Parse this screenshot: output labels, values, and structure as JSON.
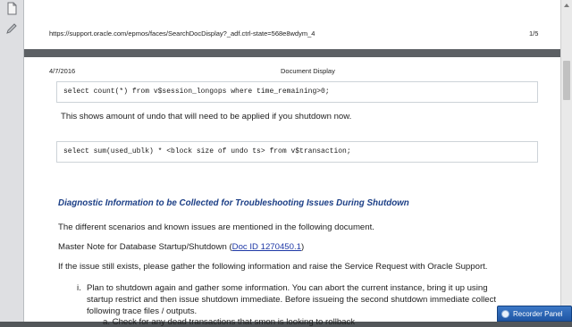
{
  "previous_page": {
    "url": "https://support.oracle.com/epmos/faces/SearchDocDisplay?_adf.ctrl-state=568e8wdym_4",
    "page_number": "1/5"
  },
  "current_page": {
    "date": "4/7/2016",
    "doc_title": "Document Display",
    "code1": "select count(*) from v$session_longops where time_remaining>0;",
    "text1": "This shows amount of undo that will need to be applied if you shutdown now.",
    "code2": "select sum(used_ublk) * <block size of undo ts> from v$transaction;",
    "heading": "Diagnostic Information to be Collected for Troubleshooting Issues During Shutdown",
    "p1": "The different scenarios and known issues are mentioned in the following document.",
    "p2_prefix": "Master Note for Database Startup/Shutdown (",
    "p2_link": "Doc ID 1270450.1",
    "p2_suffix": ")",
    "p3": "If the issue still exists, please gather the following information and raise the Service Request with Oracle Support.",
    "list_item_i_marker": "i.",
    "list_item_i_line1": "Plan to shutdown again and gather some information. You can abort the current instance, bring it up using",
    "list_item_i_line2": "startup restrict and then issue shutdown immediate. Before issueing the second shutdown immediate collect",
    "list_item_i_line3": "following trace files / outputs.",
    "sub_item_a": "a.  Check for any dead transactions that smon is looking to rollback"
  },
  "taskbar": {
    "recorder_label": "Recorder Panel"
  },
  "icons": {
    "sidebar_top": "document-icon",
    "sidebar_second": "pen-icon",
    "recorder": "record-icon"
  }
}
